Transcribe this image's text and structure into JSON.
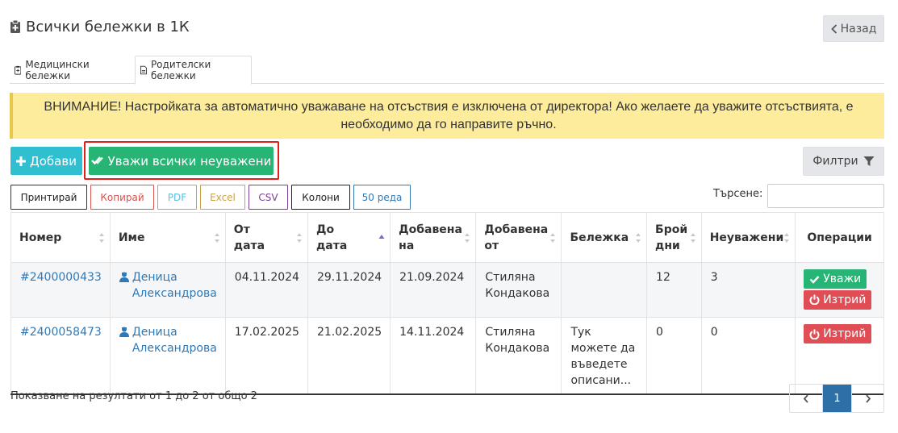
{
  "header": {
    "title": "Всички бележки в 1К",
    "back_label": "Назад"
  },
  "tabs": [
    {
      "label": "Медицински бележки",
      "active": false
    },
    {
      "label": "Родителски бележки",
      "active": true
    }
  ],
  "alert": {
    "text": "ВНИМАНИЕ! Настройката за автоматично уважаване на отсъствия е изключена от директора! Ако желаете да уважите отсъствията, е необходимо да го направите ръчно."
  },
  "toolbar": {
    "add_label": "Добави",
    "excuse_all_label": "Уважи всички неуважени",
    "filters_label": "Филтри"
  },
  "export_buttons": [
    {
      "label": "Принтирай",
      "color": "#333333"
    },
    {
      "label": "Копирай",
      "color": "#d9534f"
    },
    {
      "label": "PDF",
      "color": "#5bc0de"
    },
    {
      "label": "Excel",
      "color": "#c9a24a"
    },
    {
      "label": "CSV",
      "color": "#7b3f98"
    },
    {
      "label": "Колони",
      "color": "#222222"
    },
    {
      "label": "50 реда",
      "color": "#337ab7"
    }
  ],
  "search": {
    "label": "Търсене:",
    "value": ""
  },
  "table": {
    "columns": [
      "Номер",
      "Име",
      "От дата",
      "До дата",
      "Добавена на",
      "Добавена от",
      "Бележка",
      "Брой дни",
      "Неуважени",
      "Операции"
    ],
    "rows": [
      {
        "number": "#2400000433",
        "name": "Деница Александрова",
        "from": "04.11.2024",
        "to": "29.11.2024",
        "added_on": "21.09.2024",
        "added_by": "Стиляна Кондакова",
        "note": "",
        "days": "12",
        "unexcused": "3",
        "excuse_label": "Уважи",
        "delete_label": "Изтрий"
      },
      {
        "number": "#2400058473",
        "name": "Деница Александрова",
        "from": "17.02.2025",
        "to": "21.02.2025",
        "added_on": "14.11.2024",
        "added_by": "Стиляна Кондакова",
        "note": "Тук можете да въведете описани...",
        "days": "0",
        "unexcused": "0",
        "delete_label": "Изтрий"
      }
    ]
  },
  "footer": {
    "info": "Показване на резултати от 1 до 2 от общо 2",
    "current_page": "1"
  },
  "colors": {
    "accent_blue": "#2f6fa7",
    "success": "#26b574",
    "danger": "#e04d55",
    "info": "#2fbfd1",
    "warning_bg": "#fcec9c",
    "highlight": "#e0201c"
  },
  "icons": [
    "clipboard-icon",
    "chevron-left-icon",
    "medical-note-icon",
    "document-icon",
    "plus-icon",
    "double-check-icon",
    "filter-icon",
    "sort-icon",
    "sort-asc-icon",
    "user-icon",
    "check-icon",
    "power-icon",
    "chevron-right-icon"
  ]
}
